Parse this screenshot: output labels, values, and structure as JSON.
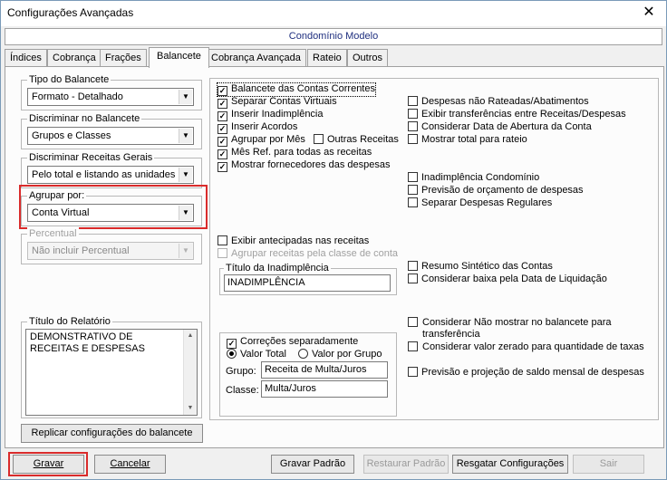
{
  "window": {
    "title": "Configurações Avançadas",
    "close_glyph": "✕"
  },
  "condominio": "Condomínio Modelo",
  "tabs": [
    "Índices",
    "Cobrança",
    "Frações",
    "Balancete",
    "Cobrança Avançada",
    "Rateio",
    "Outros"
  ],
  "left": {
    "tipo_balancete": {
      "label": "Tipo do Balancete",
      "value": "Formato - Detalhado"
    },
    "discriminar": {
      "label": "Discriminar no Balancete",
      "value": "Grupos e Classes"
    },
    "receitas": {
      "label": "Discriminar Receitas Gerais",
      "value": "Pelo total e listando as unidades"
    },
    "agrupar": {
      "label": "Agrupar por:",
      "value": "Conta Virtual"
    },
    "percentual": {
      "label": "Percentual",
      "value": "Não incluir Percentual"
    },
    "titulo_relatorio": {
      "label": "Título do Relatório",
      "value": "DEMONSTRATIVO DE RECEITAS E DESPESAS"
    },
    "replicar_button": "Replicar configurações do balancete"
  },
  "right": {
    "col1": [
      {
        "label": "Balancete das Contas Correntes",
        "checked": true
      },
      {
        "label": "Separar Contas Virtuais",
        "checked": true
      },
      {
        "label": "Inserir Inadimplência",
        "checked": true
      },
      {
        "label": "Inserir Acordos",
        "checked": true
      },
      {
        "label": "Agrupar por Mês",
        "checked": true
      },
      {
        "label": "Mês Ref. para todas as receitas",
        "checked": true
      },
      {
        "label": "Mostrar fornecedores das despesas",
        "checked": true
      }
    ],
    "outras_receitas": {
      "label": "Outras Receitas",
      "checked": false
    },
    "col2a": [
      {
        "label": "Despesas não Rateadas/Abatimentos",
        "checked": false
      },
      {
        "label": "Exibir transferências entre Receitas/Despesas",
        "checked": false
      },
      {
        "label": "Considerar Data de Abertura da Conta",
        "checked": false
      },
      {
        "label": "Mostrar total para rateio",
        "checked": false
      }
    ],
    "col2b": [
      {
        "label": "Inadimplência Condomínio",
        "checked": false
      },
      {
        "label": "Previsão de orçamento de despesas",
        "checked": false
      },
      {
        "label": "Separar Despesas Regulares",
        "checked": false
      }
    ],
    "exibir_antecipadas": {
      "label": "Exibir antecipadas nas receitas",
      "checked": false
    },
    "agrupar_receitas": {
      "label": "Agrupar receitas pela classe de conta",
      "checked": false
    },
    "titulo_inadimplencia": {
      "label": "Título da Inadimplência",
      "value": "INADIMPLÊNCIA"
    },
    "col2c": [
      {
        "label": "Resumo Sintético das Contas",
        "checked": false
      },
      {
        "label": "Considerar baixa pela Data de Liquidação",
        "checked": false
      }
    ],
    "correcoes": {
      "label": "Correções separadamente",
      "checked": true,
      "radio1": "Valor Total",
      "radio2": "Valor por Grupo",
      "grupo_label": "Grupo:",
      "grupo_value": "Receita de Multa/Juros",
      "classe_label": "Classe:",
      "classe_value": "Multa/Juros"
    },
    "col2d": [
      {
        "label": "Considerar Não mostrar no balancete para transferência",
        "checked": false
      },
      {
        "label": "Considerar valor zerado para quantidade de taxas",
        "checked": false
      },
      {
        "label": "Previsão e projeção de saldo mensal de despesas",
        "checked": false
      }
    ]
  },
  "footer": {
    "gravar": "Gravar",
    "cancelar": "Cancelar",
    "gravar_padrao": "Gravar Padrão",
    "restaurar_padrao": "Restaurar Padrão",
    "resgatar": "Resgatar Configurações",
    "sair": "Sair"
  },
  "colors": {
    "highlight": "#d92b2b",
    "condo_text": "#1f2f7f"
  }
}
